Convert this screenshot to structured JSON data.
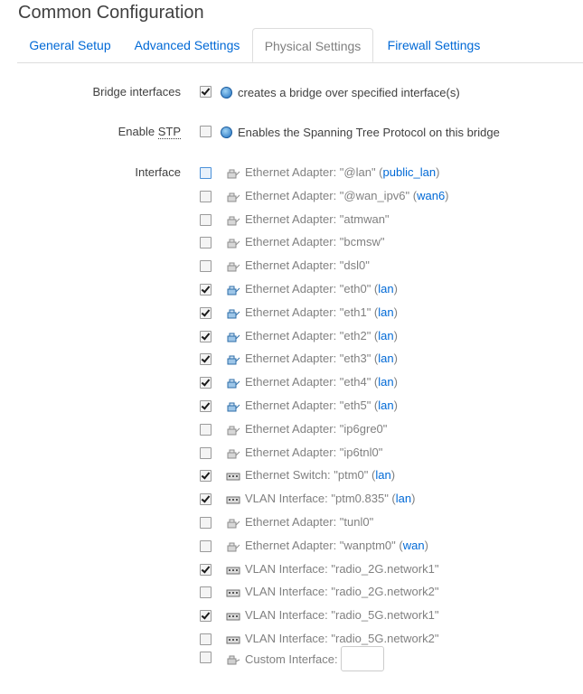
{
  "page": {
    "title": "Common Configuration"
  },
  "tabs": [
    {
      "label": "General Setup",
      "active": false
    },
    {
      "label": "Advanced Settings",
      "active": false
    },
    {
      "label": "Physical Settings",
      "active": true
    },
    {
      "label": "Firewall Settings",
      "active": false
    }
  ],
  "bridge": {
    "label": "Bridge interfaces",
    "checked": true,
    "help": "creates a bridge over specified interface(s)"
  },
  "stp": {
    "label_prefix": "Enable ",
    "label_abbr": "STP",
    "checked": false,
    "help": "Enables the Spanning Tree Protocol on this bridge"
  },
  "interface": {
    "label": "Interface",
    "items": [
      {
        "icon": "ethernet-icon",
        "text": "Ethernet Adapter: \"@lan\" (",
        "net": "public_lan",
        "suffix": ")",
        "checked": false
      },
      {
        "icon": "ethernet-icon",
        "text": "Ethernet Adapter: \"@wan_ipv6\" (",
        "net": "wan6",
        "suffix": ")",
        "checked": false
      },
      {
        "icon": "ethernet-icon",
        "text": "Ethernet Adapter: \"atmwan\"",
        "net": "",
        "suffix": "",
        "checked": false
      },
      {
        "icon": "ethernet-icon",
        "text": "Ethernet Adapter: \"bcmsw\"",
        "net": "",
        "suffix": "",
        "checked": false
      },
      {
        "icon": "ethernet-icon",
        "text": "Ethernet Adapter: \"dsl0\"",
        "net": "",
        "suffix": "",
        "checked": false
      },
      {
        "icon": "ethernet-icon",
        "text": "Ethernet Adapter: \"eth0\" (",
        "net": "lan",
        "suffix": ")",
        "checked": true
      },
      {
        "icon": "ethernet-icon",
        "text": "Ethernet Adapter: \"eth1\" (",
        "net": "lan",
        "suffix": ")",
        "checked": true
      },
      {
        "icon": "ethernet-icon",
        "text": "Ethernet Adapter: \"eth2\" (",
        "net": "lan",
        "suffix": ")",
        "checked": true
      },
      {
        "icon": "ethernet-icon",
        "text": "Ethernet Adapter: \"eth3\" (",
        "net": "lan",
        "suffix": ")",
        "checked": true
      },
      {
        "icon": "ethernet-icon",
        "text": "Ethernet Adapter: \"eth4\" (",
        "net": "lan",
        "suffix": ")",
        "checked": true
      },
      {
        "icon": "ethernet-icon",
        "text": "Ethernet Adapter: \"eth5\" (",
        "net": "lan",
        "suffix": ")",
        "checked": true
      },
      {
        "icon": "ethernet-icon",
        "text": "Ethernet Adapter: \"ip6gre0\"",
        "net": "",
        "suffix": "",
        "checked": false
      },
      {
        "icon": "ethernet-icon",
        "text": "Ethernet Adapter: \"ip6tnl0\"",
        "net": "",
        "suffix": "",
        "checked": false
      },
      {
        "icon": "switch-icon",
        "text": "Ethernet Switch: \"ptm0\" (",
        "net": "lan",
        "suffix": ")",
        "checked": true
      },
      {
        "icon": "switch-icon",
        "text": "VLAN Interface: \"ptm0.835\" (",
        "net": "lan",
        "suffix": ")",
        "checked": true
      },
      {
        "icon": "ethernet-icon",
        "text": "Ethernet Adapter: \"tunl0\"",
        "net": "",
        "suffix": "",
        "checked": false
      },
      {
        "icon": "ethernet-icon",
        "text": "Ethernet Adapter: \"wanptm0\" (",
        "net": "wan",
        "suffix": ")",
        "checked": false
      },
      {
        "icon": "switch-icon",
        "text": "VLAN Interface: \"radio_2G.network1\"",
        "net": "",
        "suffix": "",
        "checked": true
      },
      {
        "icon": "switch-icon",
        "text": "VLAN Interface: \"radio_2G.network2\"",
        "net": "",
        "suffix": "",
        "checked": false
      },
      {
        "icon": "switch-icon",
        "text": "VLAN Interface: \"radio_5G.network1\"",
        "net": "",
        "suffix": "",
        "checked": true
      },
      {
        "icon": "switch-icon",
        "text": "VLAN Interface: \"radio_5G.network2\"",
        "net": "",
        "suffix": "",
        "checked": false
      }
    ],
    "custom": {
      "label": "Custom Interface:",
      "value": "",
      "checked": false
    }
  }
}
